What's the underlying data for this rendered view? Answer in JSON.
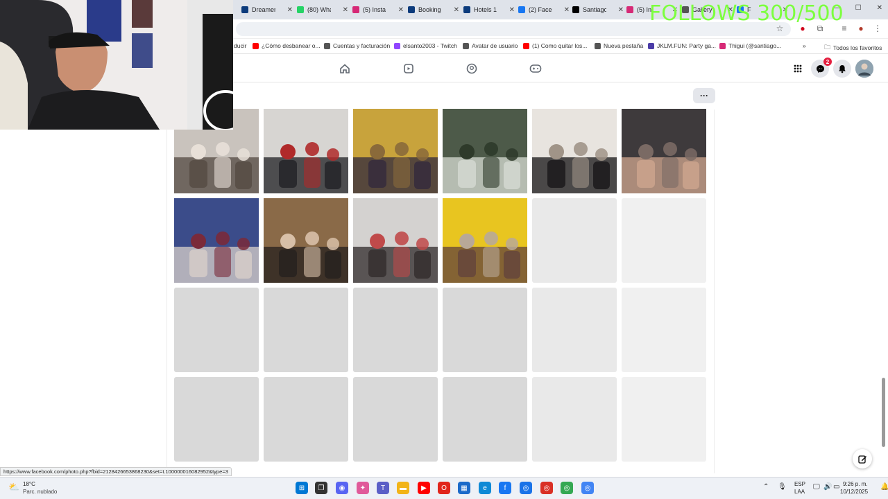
{
  "browser": {
    "tabs": [
      {
        "label": "Dreamer",
        "icon": "booking-b-icon",
        "color": "#0c3b7c"
      },
      {
        "label": "(80) Wha",
        "icon": "whatsapp-icon",
        "color": "#25d366"
      },
      {
        "label": "(5) Insta",
        "icon": "instagram-icon",
        "color": "#d62976"
      },
      {
        "label": "Booking",
        "icon": "booking-b-icon",
        "color": "#0c3b7c"
      },
      {
        "label": "Hotels 1",
        "icon": "booking-b-icon",
        "color": "#0c3b7c"
      },
      {
        "label": "(2) Faceb",
        "icon": "facebook-icon",
        "color": "#1877f2"
      },
      {
        "label": "Santiago",
        "icon": "tiktok-icon",
        "color": "#000000"
      },
      {
        "label": "(5) In",
        "icon": "instagram-icon",
        "color": "#d62976"
      },
      {
        "label": "Gallery",
        "icon": "gear-icon",
        "color": "#555555"
      },
      {
        "label": "F",
        "icon": "facebook-icon",
        "color": "#1877f2"
      }
    ],
    "bookmarks": [
      {
        "label": "ducir",
        "color": "#ffffff"
      },
      {
        "label": "¿Cómo desbanear o...",
        "color": "#ff0000"
      },
      {
        "label": "Cuentas y facturación",
        "color": "#555555"
      },
      {
        "label": "elsanto2003 - Twitch",
        "color": "#9146ff"
      },
      {
        "label": "Avatar de usuario",
        "color": "#555555"
      },
      {
        "label": "(1) Como quitar los...",
        "color": "#ff0000"
      },
      {
        "label": "Nueva pestaña",
        "color": "#555555"
      },
      {
        "label": "JKLM.FUN: Party ga...",
        "color": "#4b3ca7"
      },
      {
        "label": "Thigui (@santiago...",
        "color": "#d62976"
      }
    ],
    "bookmarks_more": "»",
    "all_favorites": "Todos los favoritos",
    "status_url": "https://www.facebook.com/photo.php?fbid=2128426653868230&set=t.100000016082952&type=3"
  },
  "overlay": {
    "follows_text": "FOLLOWS 300/500"
  },
  "facebook": {
    "nav_icons": [
      "home-icon",
      "reels-video-icon",
      "groups-icon",
      "gaming-icon"
    ],
    "notifications_count": "2",
    "more_label": "···",
    "compose_icon": "compose-icon",
    "photos": [
      {
        "colors": [
          "#c9c3bd",
          "#5a5048",
          "#e8e0d8"
        ]
      },
      {
        "colors": [
          "#d7d5d2",
          "#2a2a2e",
          "#b02a2a"
        ]
      },
      {
        "colors": [
          "#c8a33c",
          "#3a2f3c",
          "#8a6a3a"
        ]
      },
      {
        "colors": [
          "#4d5a49",
          "#cfd4cc",
          "#2e3a2a"
        ]
      },
      {
        "colors": [
          "#e8e4df",
          "#222022",
          "#a09488"
        ]
      },
      {
        "colors": [
          "#3e3a3c",
          "#c7a08a",
          "#7a6a64"
        ]
      },
      {
        "colors": [
          "#3b4c8a",
          "#d0c8c6",
          "#7a2a3a"
        ]
      },
      {
        "colors": [
          "#8a6a48",
          "#2a2420",
          "#d8c0a8"
        ]
      },
      {
        "colors": [
          "#d4d2d0",
          "#3a3434",
          "#c04a4a"
        ]
      },
      {
        "colors": [
          "#e8c520",
          "#6a4a3a",
          "#b8a898"
        ]
      }
    ]
  },
  "taskbar": {
    "weather_temp": "18°C",
    "weather_desc": "Parc. nublado",
    "language": "ESP",
    "layout": "LAA",
    "time": "9:26 p. m.",
    "date": "10/12/2025",
    "apps": [
      {
        "icon": "windows-start-icon",
        "color": "#0078d4"
      },
      {
        "icon": "task-view-icon",
        "color": "#333333"
      },
      {
        "icon": "discord-icon",
        "color": "#5865f2"
      },
      {
        "icon": "copilot-icon",
        "color": "#e05a9a"
      },
      {
        "icon": "teams-icon",
        "color": "#5b5fc7"
      },
      {
        "icon": "file-explorer-icon",
        "color": "#f2b418"
      },
      {
        "icon": "youtube-icon",
        "color": "#ff0000"
      },
      {
        "icon": "opera-icon",
        "color": "#e1251b"
      },
      {
        "icon": "store-icon",
        "color": "#1b6ac9"
      },
      {
        "icon": "edge-icon",
        "color": "#0f8ad6"
      },
      {
        "icon": "facebook-icon",
        "color": "#1877f2"
      },
      {
        "icon": "chrome-icon",
        "color": "#1a73e8"
      },
      {
        "icon": "chrome-icon",
        "color": "#d93025"
      },
      {
        "icon": "chrome-icon",
        "color": "#34a853"
      },
      {
        "icon": "chrome-icon",
        "color": "#4285f4"
      }
    ]
  }
}
